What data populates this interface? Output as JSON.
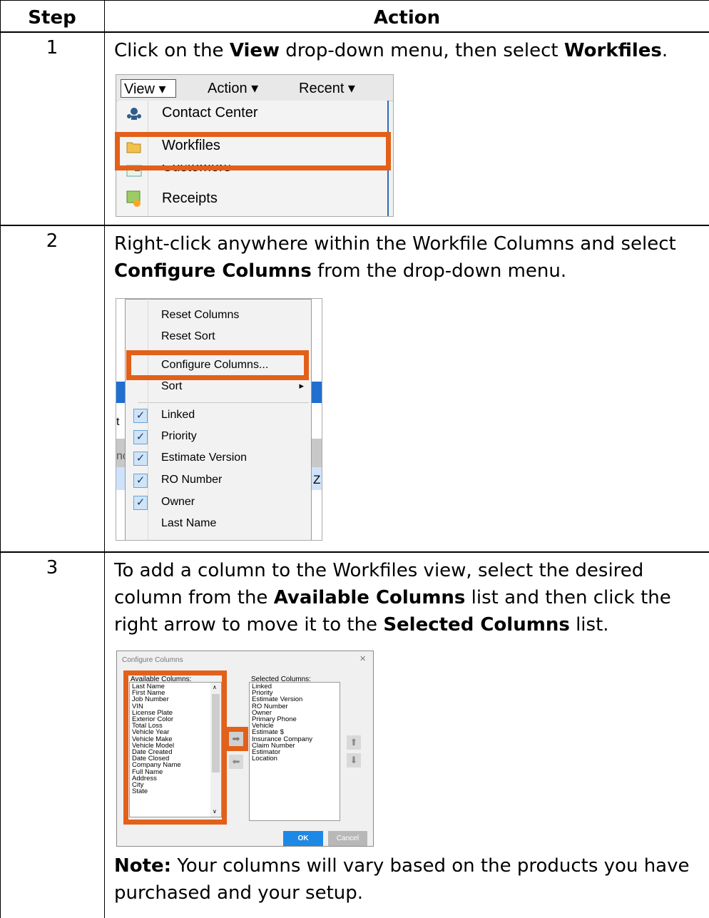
{
  "table": {
    "header_step": "Step",
    "header_action": "Action"
  },
  "steps": [
    {
      "number": "1",
      "text_1": "Click on the ",
      "bold_1": "View",
      "text_2": " drop-down menu, then select ",
      "bold_2": "Workfiles",
      "text_3": "."
    },
    {
      "number": "2",
      "text_1": "Right-click anywhere within the Workfile Columns and select ",
      "bold_1": "Configure Columns",
      "text_2": " from the drop-down menu."
    },
    {
      "number": "3",
      "text_1": "To add a column to the Workfiles view, select the desired column from the ",
      "bold_1": "Available Columns",
      "text_2": " list and then click the right arrow to move it to the ",
      "bold_2": "Selected Columns",
      "text_3": " list.",
      "note_label": "Note:",
      "note_text": " Your columns will vary based on the products you have purchased and your setup."
    }
  ],
  "screenshot1": {
    "menubar": [
      "View ▾",
      "Action ▾",
      "Recent ▾"
    ],
    "items": [
      {
        "label": "Contact Center",
        "icon": "contact-center-icon"
      },
      {
        "label": "Workfiles",
        "icon": "folder-icon"
      },
      {
        "label": "Customers",
        "icon": "customers-icon"
      },
      {
        "label": "Receipts",
        "icon": "receipts-icon"
      }
    ]
  },
  "screenshot2": {
    "items": [
      "Reset Columns",
      "Reset Sort",
      "Configure Columns...",
      "Sort",
      "Linked",
      "Priority",
      "Estimate Version",
      "RO Number",
      "Owner",
      "Last Name"
    ],
    "checked": [
      "Linked",
      "Priority",
      "Estimate Version",
      "RO Number",
      "Owner"
    ],
    "submenu_arrow": "▸",
    "left_fragments": [
      "t",
      "nc"
    ],
    "right_fragment": "Z"
  },
  "screenshot3": {
    "title": "Configure Columns",
    "close": "✕",
    "available_label": "Available Columns:",
    "available": [
      "Last Name",
      "First Name",
      "Job Number",
      "VIN",
      "License Plate",
      "Exterior Color",
      "Total Loss",
      "Vehicle Year",
      "Vehicle Make",
      "Vehicle Model",
      "Date Created",
      "Date Closed",
      "Company Name",
      "Full Name",
      "Address",
      "City",
      "State"
    ],
    "selected_label": "Selected Columns:",
    "selected": [
      "Linked",
      "Priority",
      "Estimate Version",
      "RO Number",
      "Owner",
      "Primary Phone",
      "Vehicle",
      "Estimate $",
      "Insurance Company",
      "Claim Number",
      "Estimator",
      "Location"
    ],
    "ok": "OK",
    "cancel": "Cancel"
  },
  "colors": {
    "highlight": "#e2601a",
    "ok_button": "#1e88e5"
  }
}
